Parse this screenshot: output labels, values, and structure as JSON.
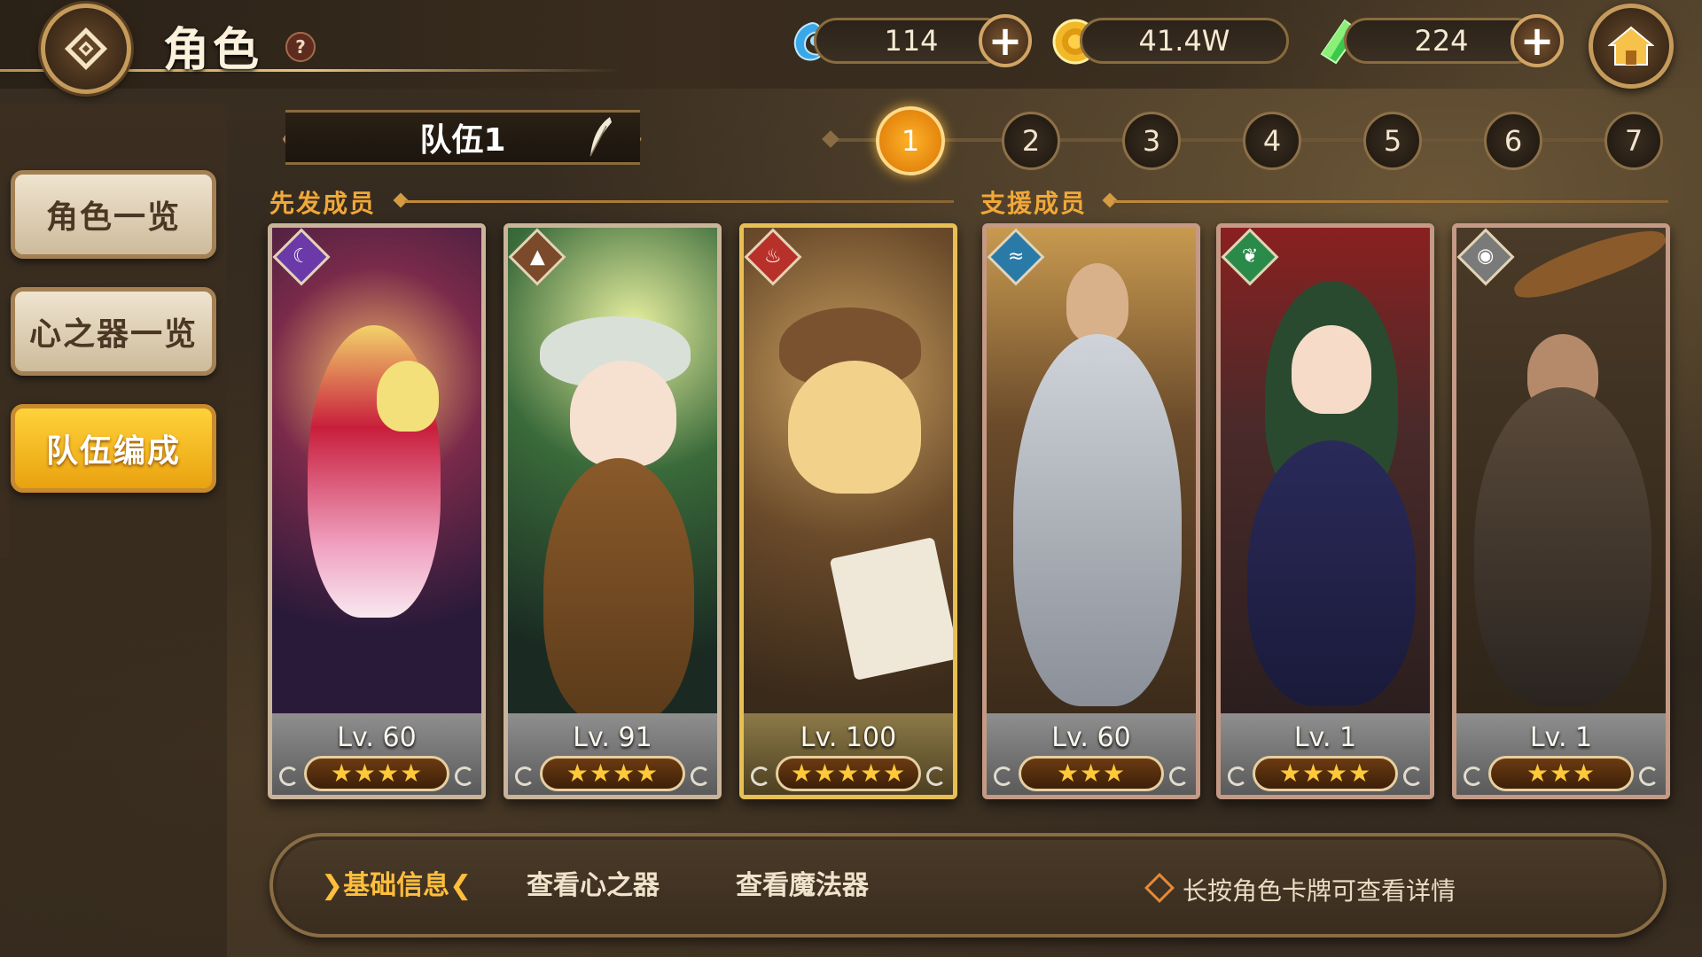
{
  "header": {
    "title": "角色",
    "help_symbol": "?",
    "currencies": [
      {
        "icon": "blue-orb-icon",
        "value": "114",
        "has_plus": true
      },
      {
        "icon": "gold-coin-icon",
        "value": "41.4W",
        "has_plus": false
      },
      {
        "icon": "green-gem-icon",
        "value": "224",
        "has_plus": true
      }
    ],
    "plus_symbol": "+"
  },
  "sidebar": {
    "items": [
      {
        "label": "角色一览",
        "active": false
      },
      {
        "label": "心之器一览",
        "active": false
      },
      {
        "label": "队伍编成",
        "active": true
      }
    ]
  },
  "team": {
    "name": "队伍1",
    "pages": [
      "1",
      "2",
      "3",
      "4",
      "5",
      "6",
      "7"
    ],
    "active_page": "1"
  },
  "sections": {
    "starters": "先发成员",
    "support": "支援成员"
  },
  "cards": [
    {
      "level": "Lv. 60",
      "stars": "★★★★",
      "element": "dark",
      "element_icon": "moon-icon",
      "element_color": "#6b3aa8"
    },
    {
      "level": "Lv. 91",
      "stars": "★★★★",
      "element": "earth",
      "element_icon": "mountain-icon",
      "element_color": "#7a4a2a"
    },
    {
      "level": "Lv. 100",
      "stars": "★★★★★",
      "element": "fire",
      "element_icon": "flame-icon",
      "element_color": "#b8302a"
    },
    {
      "level": "Lv. 60",
      "stars": "★★★",
      "element": "water",
      "element_icon": "wave-icon",
      "element_color": "#2a7aa8"
    },
    {
      "level": "Lv. 1",
      "stars": "★★★★",
      "element": "wind",
      "element_icon": "leaf-icon",
      "element_color": "#2a8a4a"
    },
    {
      "level": "Lv. 1",
      "stars": "★★★",
      "element": "neutral",
      "element_icon": "eye-icon",
      "element_color": "#7a7a7a"
    }
  ],
  "bottom": {
    "tabs": [
      {
        "label": "基础信息",
        "active": true
      },
      {
        "label": "查看心之器",
        "active": false
      },
      {
        "label": "查看魔法器",
        "active": false
      }
    ],
    "hint": "长按角色卡牌可查看详情"
  },
  "colors": {
    "accent_gold": "#f0a83a",
    "active_page": "#e0800a",
    "sidebar_active": "#e9a20f"
  }
}
